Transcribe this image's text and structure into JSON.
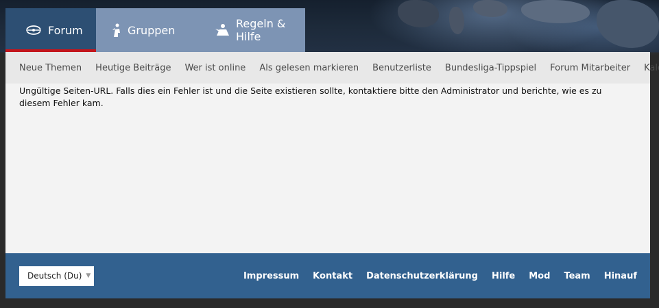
{
  "tabs": [
    {
      "label": "Forum",
      "icon": "forum-swirl-icon"
    },
    {
      "label": "Gruppen",
      "icon": "groups-figure-icon"
    },
    {
      "label": "Regeln & Hilfe",
      "icon": "rules-figure-icon"
    }
  ],
  "subnav": [
    "Neue Themen",
    "Heutige Beiträge",
    "Wer ist online",
    "Als gelesen markieren",
    "Benutzerliste",
    "Bundesliga-Tippspiel",
    "Forum Mitarbeiter",
    "Kalender"
  ],
  "message": "Ungültige Seiten-URL. Falls dies ein Fehler ist und die Seite existieren sollte, kontaktiere bitte den Administrator und berichte, wie es zu diesem Fehler kam.",
  "footer": {
    "language": "Deutsch (Du)",
    "links": [
      "Impressum",
      "Kontakt",
      "Datenschutzerklärung",
      "Hilfe",
      "Mod",
      "Team",
      "Hinauf"
    ]
  },
  "colors": {
    "active_tab": "#2d4f73",
    "inactive_tab": "#7d94b4",
    "accent_red": "#c4161c",
    "footer": "#32618f"
  }
}
